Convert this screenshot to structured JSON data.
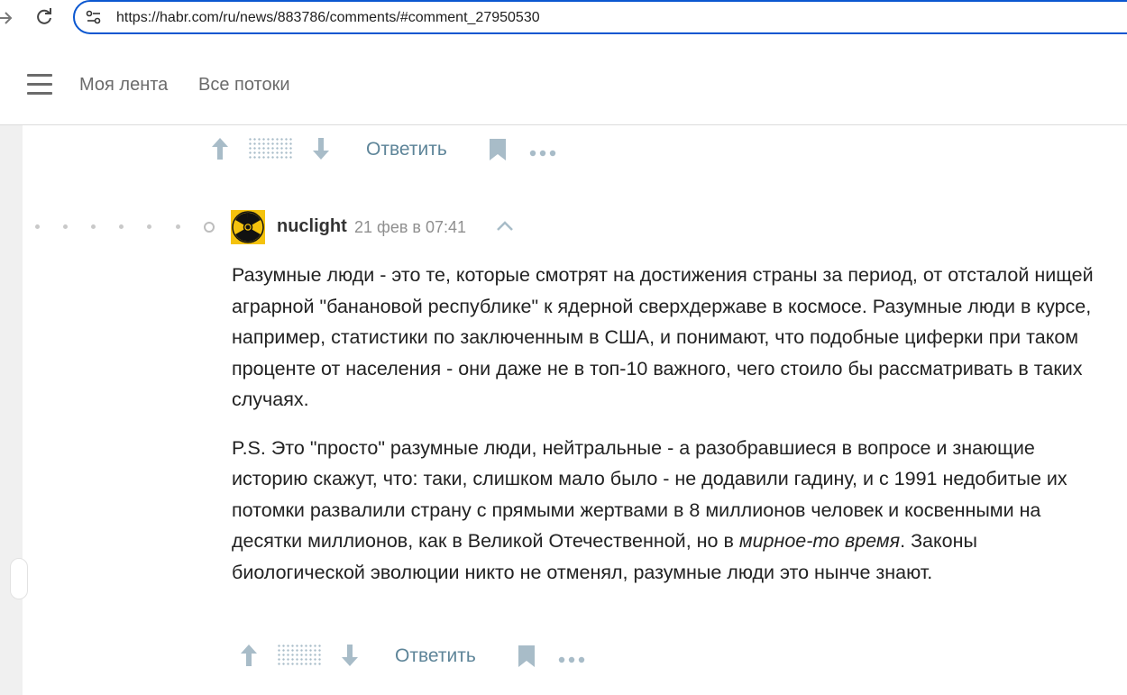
{
  "browser": {
    "url": "https://habr.com/ru/news/883786/comments/#comment_27950530"
  },
  "header": {
    "nav": [
      "Моя лента",
      "Все потоки"
    ]
  },
  "previous_comment_actions": {
    "reply_label": "Ответить"
  },
  "comment": {
    "username": "nuclight",
    "timestamp": "21 фев в 07:41",
    "paragraph1": "Разумные люди - это те, которые смотрят на достижения страны за период, от отсталой нищей аграрной \"банановой республике\" к ядерной сверхдержаве в космосе. Разумные люди в курсе, например, статистики по заключенным в США, и понимают, что подобные циферки при таком проценте от населения - они даже не в топ-10 важного, чего стоило бы рассматривать в таких случаях.",
    "paragraph2_part1": "P.S. Это \"просто\" разумные люди, нейтральные - а разобравшиеся в вопросе и знающие историю скажут, что: таки, слишком мало было - не додавили гадину, и с 1991 недобитые их потомки развалили страну с прямыми жертвами в 8 миллионов человек и косвенными на десятки миллионов, как в Великой Отечественной, но в ",
    "paragraph2_emphasis": "мирное-то время",
    "paragraph2_part2": ". Законы биологической эволюции никто не отменял, разумные люди это нынче знают.",
    "reply_label": "Ответить"
  },
  "colors": {
    "accent": "#0b57d0",
    "link": "#5e8599",
    "icon": "#a8bcc8"
  },
  "icons": [
    "back-arrow-icon",
    "reload-icon",
    "site-info-icon",
    "hamburger-menu-icon",
    "arrow-up-icon",
    "arrow-down-icon",
    "bookmark-icon",
    "more-icon",
    "radiation-avatar",
    "chevron-up-icon"
  ]
}
